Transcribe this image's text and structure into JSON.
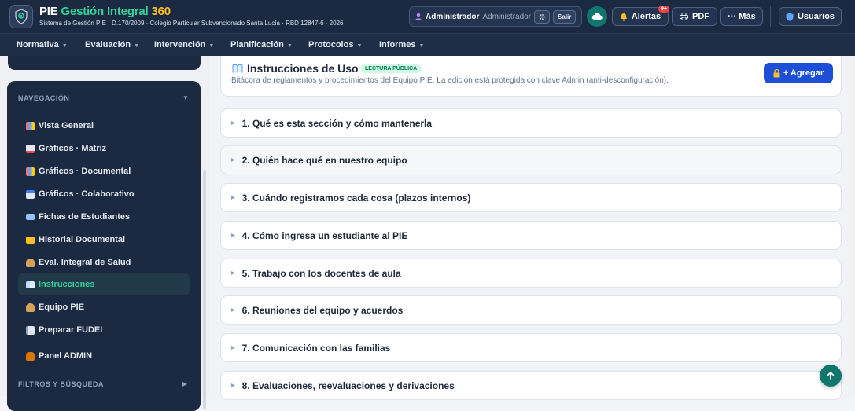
{
  "header": {
    "brand_pie": "PIE",
    "brand_gestion": "Gestión Integral",
    "brand_num": "360",
    "subtitle": "Sistema de Gestión PIE · D.170/2009 · Colegio Particular Subvencionado Santa Lucía · RBD 12847-6 · 2026",
    "user_role": "Administrador",
    "user_role_secondary": "Administrador",
    "logout_label": "Salir",
    "alerts_label": "Alertas",
    "alerts_count": "9+",
    "pdf_label": "PDF",
    "more_label": "··· Más",
    "users_label": "Usuarios"
  },
  "navbar": {
    "items": [
      {
        "label": "Normativa"
      },
      {
        "label": "Evaluación"
      },
      {
        "label": "Intervención"
      },
      {
        "label": "Planificación"
      },
      {
        "label": "Protocolos"
      },
      {
        "label": "Informes"
      }
    ]
  },
  "sidebar": {
    "nav_heading": "NAVEGACIÓN",
    "filter_heading": "FILTROS Y BÚSQUEDA",
    "items": [
      {
        "label": "Vista General",
        "icon": "bar-chart-icon"
      },
      {
        "label": "Gráficos · Matriz",
        "icon": "chart-increasing-icon"
      },
      {
        "label": "Gráficos · Documental",
        "icon": "bar-chart-icon"
      },
      {
        "label": "Gráficos · Colaborativo",
        "icon": "chart-decreasing-icon"
      },
      {
        "label": "Fichas de Estudiantes",
        "icon": "id-card-icon"
      },
      {
        "label": "Historial Documental",
        "icon": "folder-icon"
      },
      {
        "label": "Eval. Integral de Salud",
        "icon": "person-icon"
      },
      {
        "label": "Instrucciones",
        "icon": "book-icon"
      },
      {
        "label": "Equipo PIE",
        "icon": "person-icon"
      },
      {
        "label": "Preparar FUDEI",
        "icon": "memo-icon"
      },
      {
        "label": "Panel ADMIN",
        "icon": "lock-icon"
      }
    ]
  },
  "main": {
    "title": "Instrucciones de Uso ·",
    "badge": "LECTURA PÚBLICA",
    "description": "Bitácora de reglamentos y procedimientos del Equipo PIE. La edición está protegida con clave Admin (anti-desconfiguración).",
    "add_label": "+ Agregar",
    "sections": [
      {
        "label": "1. Qué es esta sección y cómo mantenerla"
      },
      {
        "label": "2. Quién hace qué en nuestro equipo"
      },
      {
        "label": "3. Cuándo registramos cada cosa (plazos internos)"
      },
      {
        "label": "4. Cómo ingresa un estudiante al PIE"
      },
      {
        "label": "5. Trabajo con los docentes de aula"
      },
      {
        "label": "6. Reuniones del equipo y acuerdos"
      },
      {
        "label": "7. Comunicación con las familias"
      },
      {
        "label": "8. Evaluaciones, reevaluaciones y derivaciones"
      }
    ]
  },
  "colors": {
    "topbar": "#1b2a41",
    "accent_green": "#34d399",
    "accent_blue": "#1d4ed8",
    "brand_gold": "#fbbf24",
    "badge_red": "#ef4444"
  }
}
